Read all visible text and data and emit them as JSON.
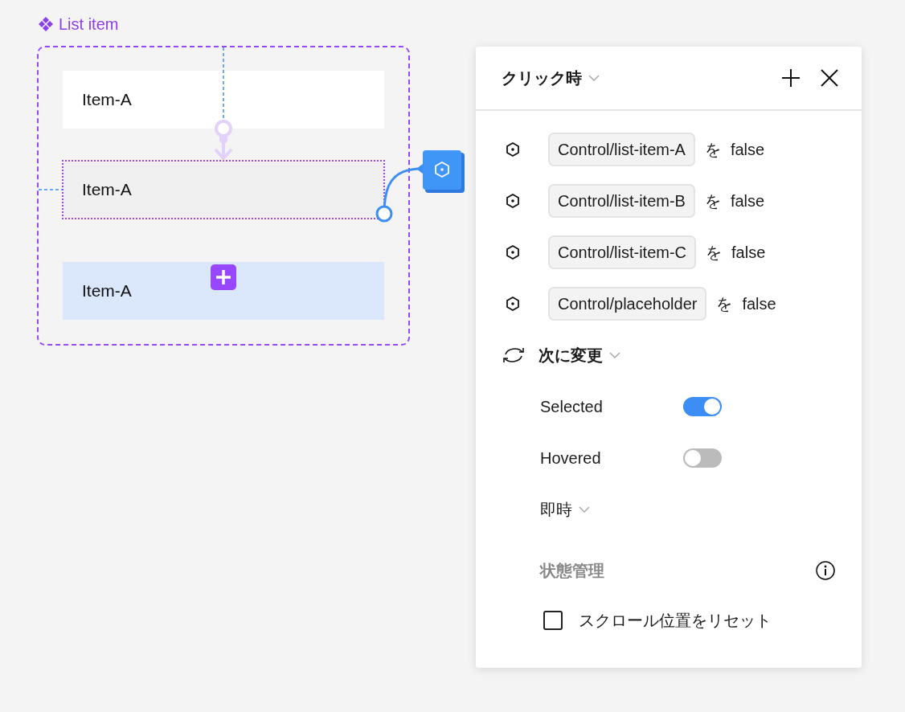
{
  "component": {
    "title": "List item",
    "items": [
      {
        "label": "Item-A",
        "kind": "default"
      },
      {
        "label": "Item-A",
        "kind": "hover"
      },
      {
        "label": "Item-A",
        "kind": "selected"
      }
    ]
  },
  "panel": {
    "trigger": "クリック時",
    "actions": [
      {
        "target": "Control/list-item-A",
        "particle": "を",
        "value": "false"
      },
      {
        "target": "Control/list-item-B",
        "particle": "を",
        "value": "false"
      },
      {
        "target": "Control/list-item-C",
        "particle": "を",
        "value": "false"
      },
      {
        "target": "Control/placeholder",
        "particle": "を",
        "value": "false"
      }
    ],
    "change": {
      "label": "次に変更",
      "properties": [
        {
          "name": "Selected",
          "on": true
        },
        {
          "name": "Hovered",
          "on": false
        }
      ]
    },
    "transition": "即時",
    "state_section": {
      "title": "状態管理",
      "options": [
        {
          "label": "スクロール位置をリセット",
          "checked": false
        }
      ]
    }
  }
}
